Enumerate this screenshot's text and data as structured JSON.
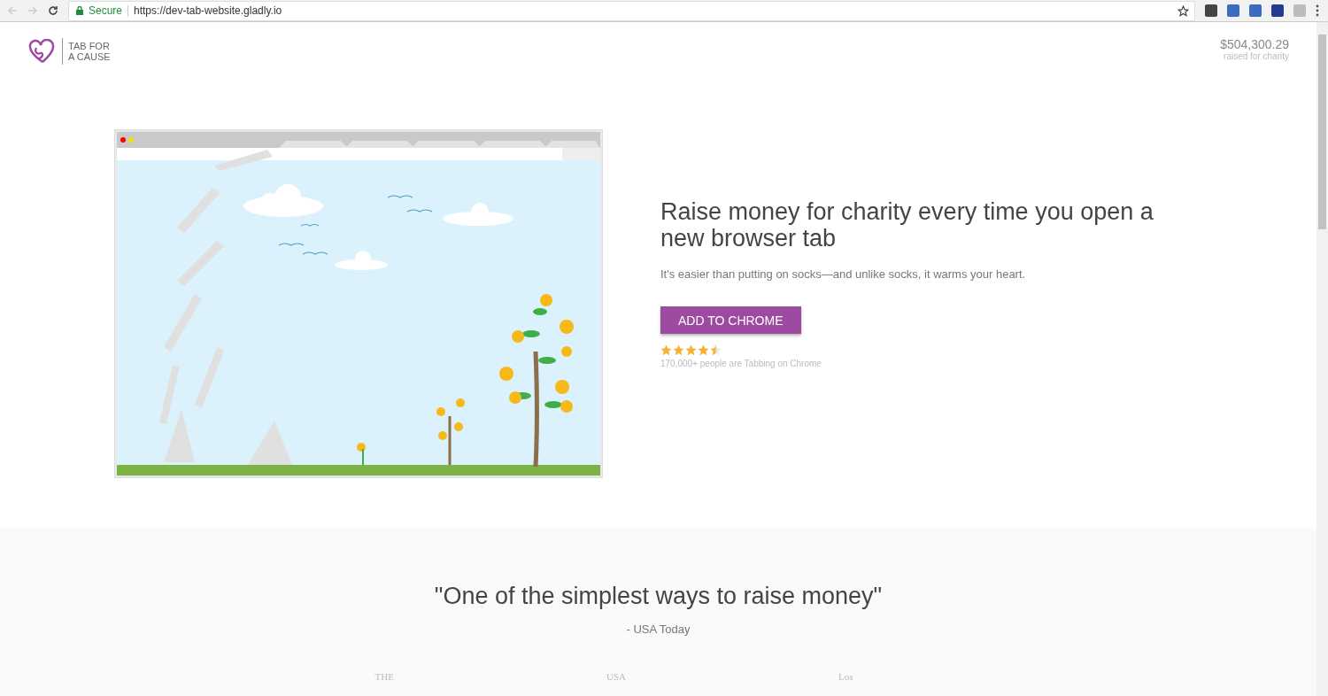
{
  "browser": {
    "secure_label": "Secure",
    "url": "https://dev-tab-website.gladly.io"
  },
  "header": {
    "logo_text": [
      "TAB FOR",
      "A CAUSE"
    ],
    "amount": "$504,300.29",
    "amount_caption": "raised for charity"
  },
  "hero": {
    "title": "Raise money for charity every time you open a new browser tab",
    "subtitle": "It's easier than putting on socks—and unlike socks, it warms your heart.",
    "button": "ADD TO CHROME",
    "stars": 4.5,
    "rating_caption": "170,000+ people are Tabbing on Chrome"
  },
  "press": {
    "quote": "\"One of the simplest ways to raise money\"",
    "source": "- USA Today",
    "logos": [
      "THE",
      "USA",
      "Los"
    ]
  }
}
